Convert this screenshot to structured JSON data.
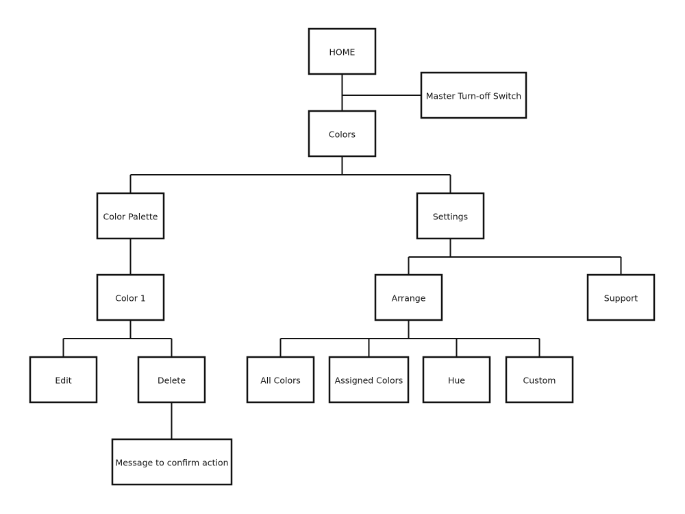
{
  "diagram": {
    "type": "sitemap-tree",
    "nodes": [
      {
        "id": "home",
        "label": "HOME"
      },
      {
        "id": "master",
        "label": "Master Turn-off Switch"
      },
      {
        "id": "colors",
        "label": "Colors"
      },
      {
        "id": "palette",
        "label": "Color Palette"
      },
      {
        "id": "settings",
        "label": "Settings"
      },
      {
        "id": "color1",
        "label": "Color 1"
      },
      {
        "id": "arrange",
        "label": "Arrange"
      },
      {
        "id": "support",
        "label": "Support"
      },
      {
        "id": "edit",
        "label": "Edit"
      },
      {
        "id": "delete",
        "label": "Delete"
      },
      {
        "id": "allcolors",
        "label": "All Colors"
      },
      {
        "id": "assigned",
        "label": "Assigned Colors"
      },
      {
        "id": "hue",
        "label": "Hue"
      },
      {
        "id": "custom",
        "label": "Custom"
      },
      {
        "id": "confirm",
        "label": "Message to confirm action"
      }
    ],
    "edges": [
      [
        "home",
        "colors"
      ],
      [
        "home",
        "master"
      ],
      [
        "colors",
        "palette"
      ],
      [
        "colors",
        "settings"
      ],
      [
        "palette",
        "color1"
      ],
      [
        "color1",
        "edit"
      ],
      [
        "color1",
        "delete"
      ],
      [
        "delete",
        "confirm"
      ],
      [
        "settings",
        "arrange"
      ],
      [
        "settings",
        "support"
      ],
      [
        "arrange",
        "allcolors"
      ],
      [
        "arrange",
        "assigned"
      ],
      [
        "arrange",
        "hue"
      ],
      [
        "arrange",
        "custom"
      ]
    ]
  }
}
